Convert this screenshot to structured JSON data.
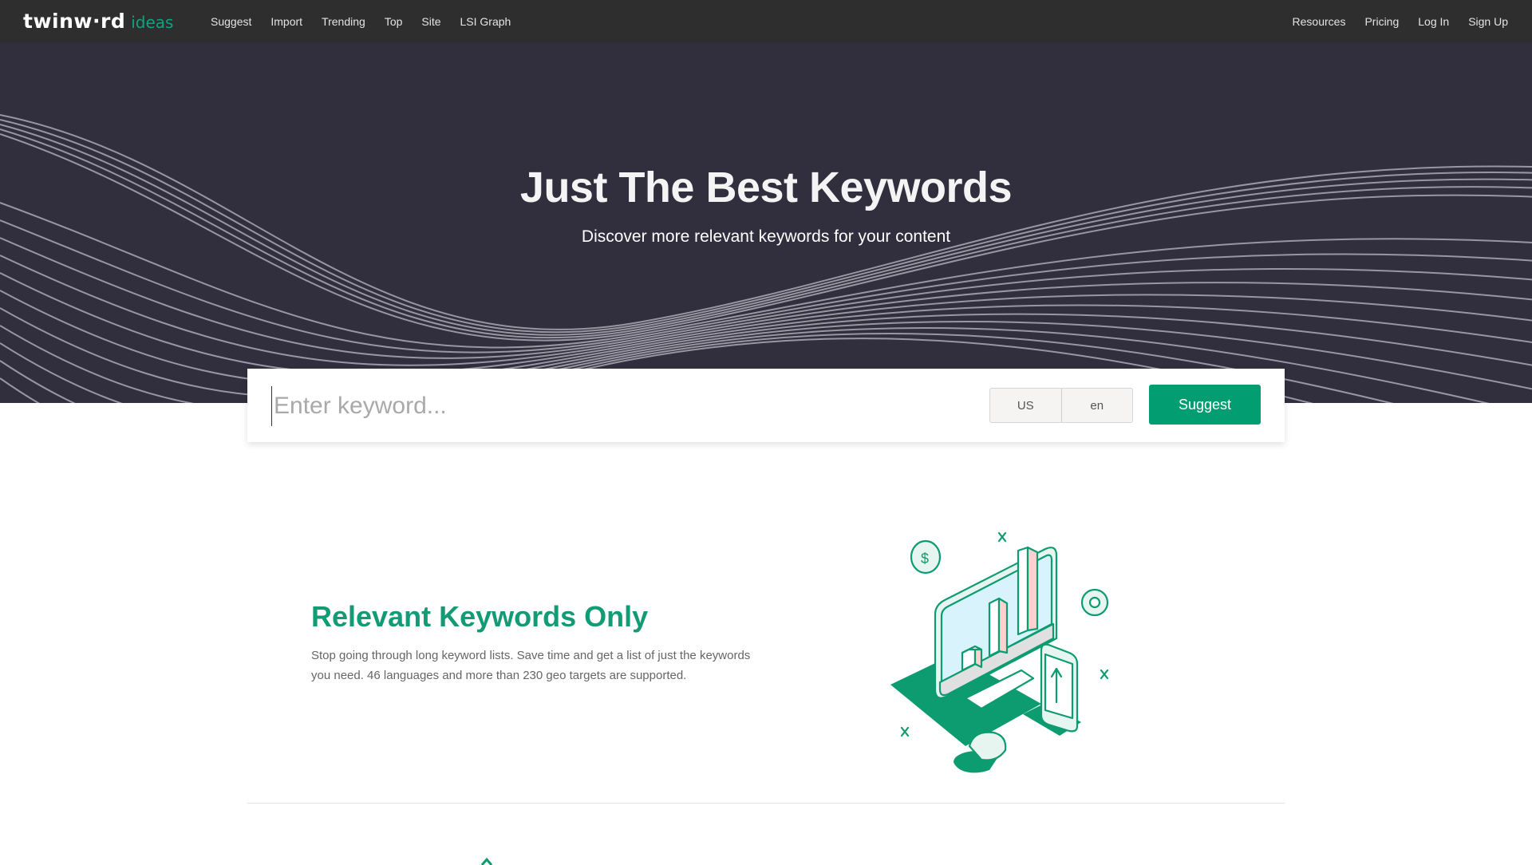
{
  "brand": {
    "logo_main": "twinw·rd",
    "logo_sub": "ideas",
    "accent_color": "#029e72"
  },
  "nav": {
    "left": [
      {
        "label": "Suggest"
      },
      {
        "label": "Import"
      },
      {
        "label": "Trending"
      },
      {
        "label": "Top"
      },
      {
        "label": "Site"
      },
      {
        "label": "LSI Graph"
      }
    ],
    "right": [
      {
        "label": "Resources"
      },
      {
        "label": "Pricing"
      },
      {
        "label": "Log In"
      },
      {
        "label": "Sign Up"
      }
    ]
  },
  "hero": {
    "title": "Just The Best Keywords",
    "subtitle": "Discover more relevant keywords for your content"
  },
  "search": {
    "placeholder": "Enter keyword...",
    "value": "",
    "country": "US",
    "language": "en",
    "submit_label": "Suggest"
  },
  "feature": {
    "title": "Relevant Keywords Only",
    "description": "Stop going through long keyword lists. Save time and get a list of just the keywords you need. 46 languages and more than 230 geo targets are supported.",
    "illustration": "analytics-desktop-illustration"
  }
}
